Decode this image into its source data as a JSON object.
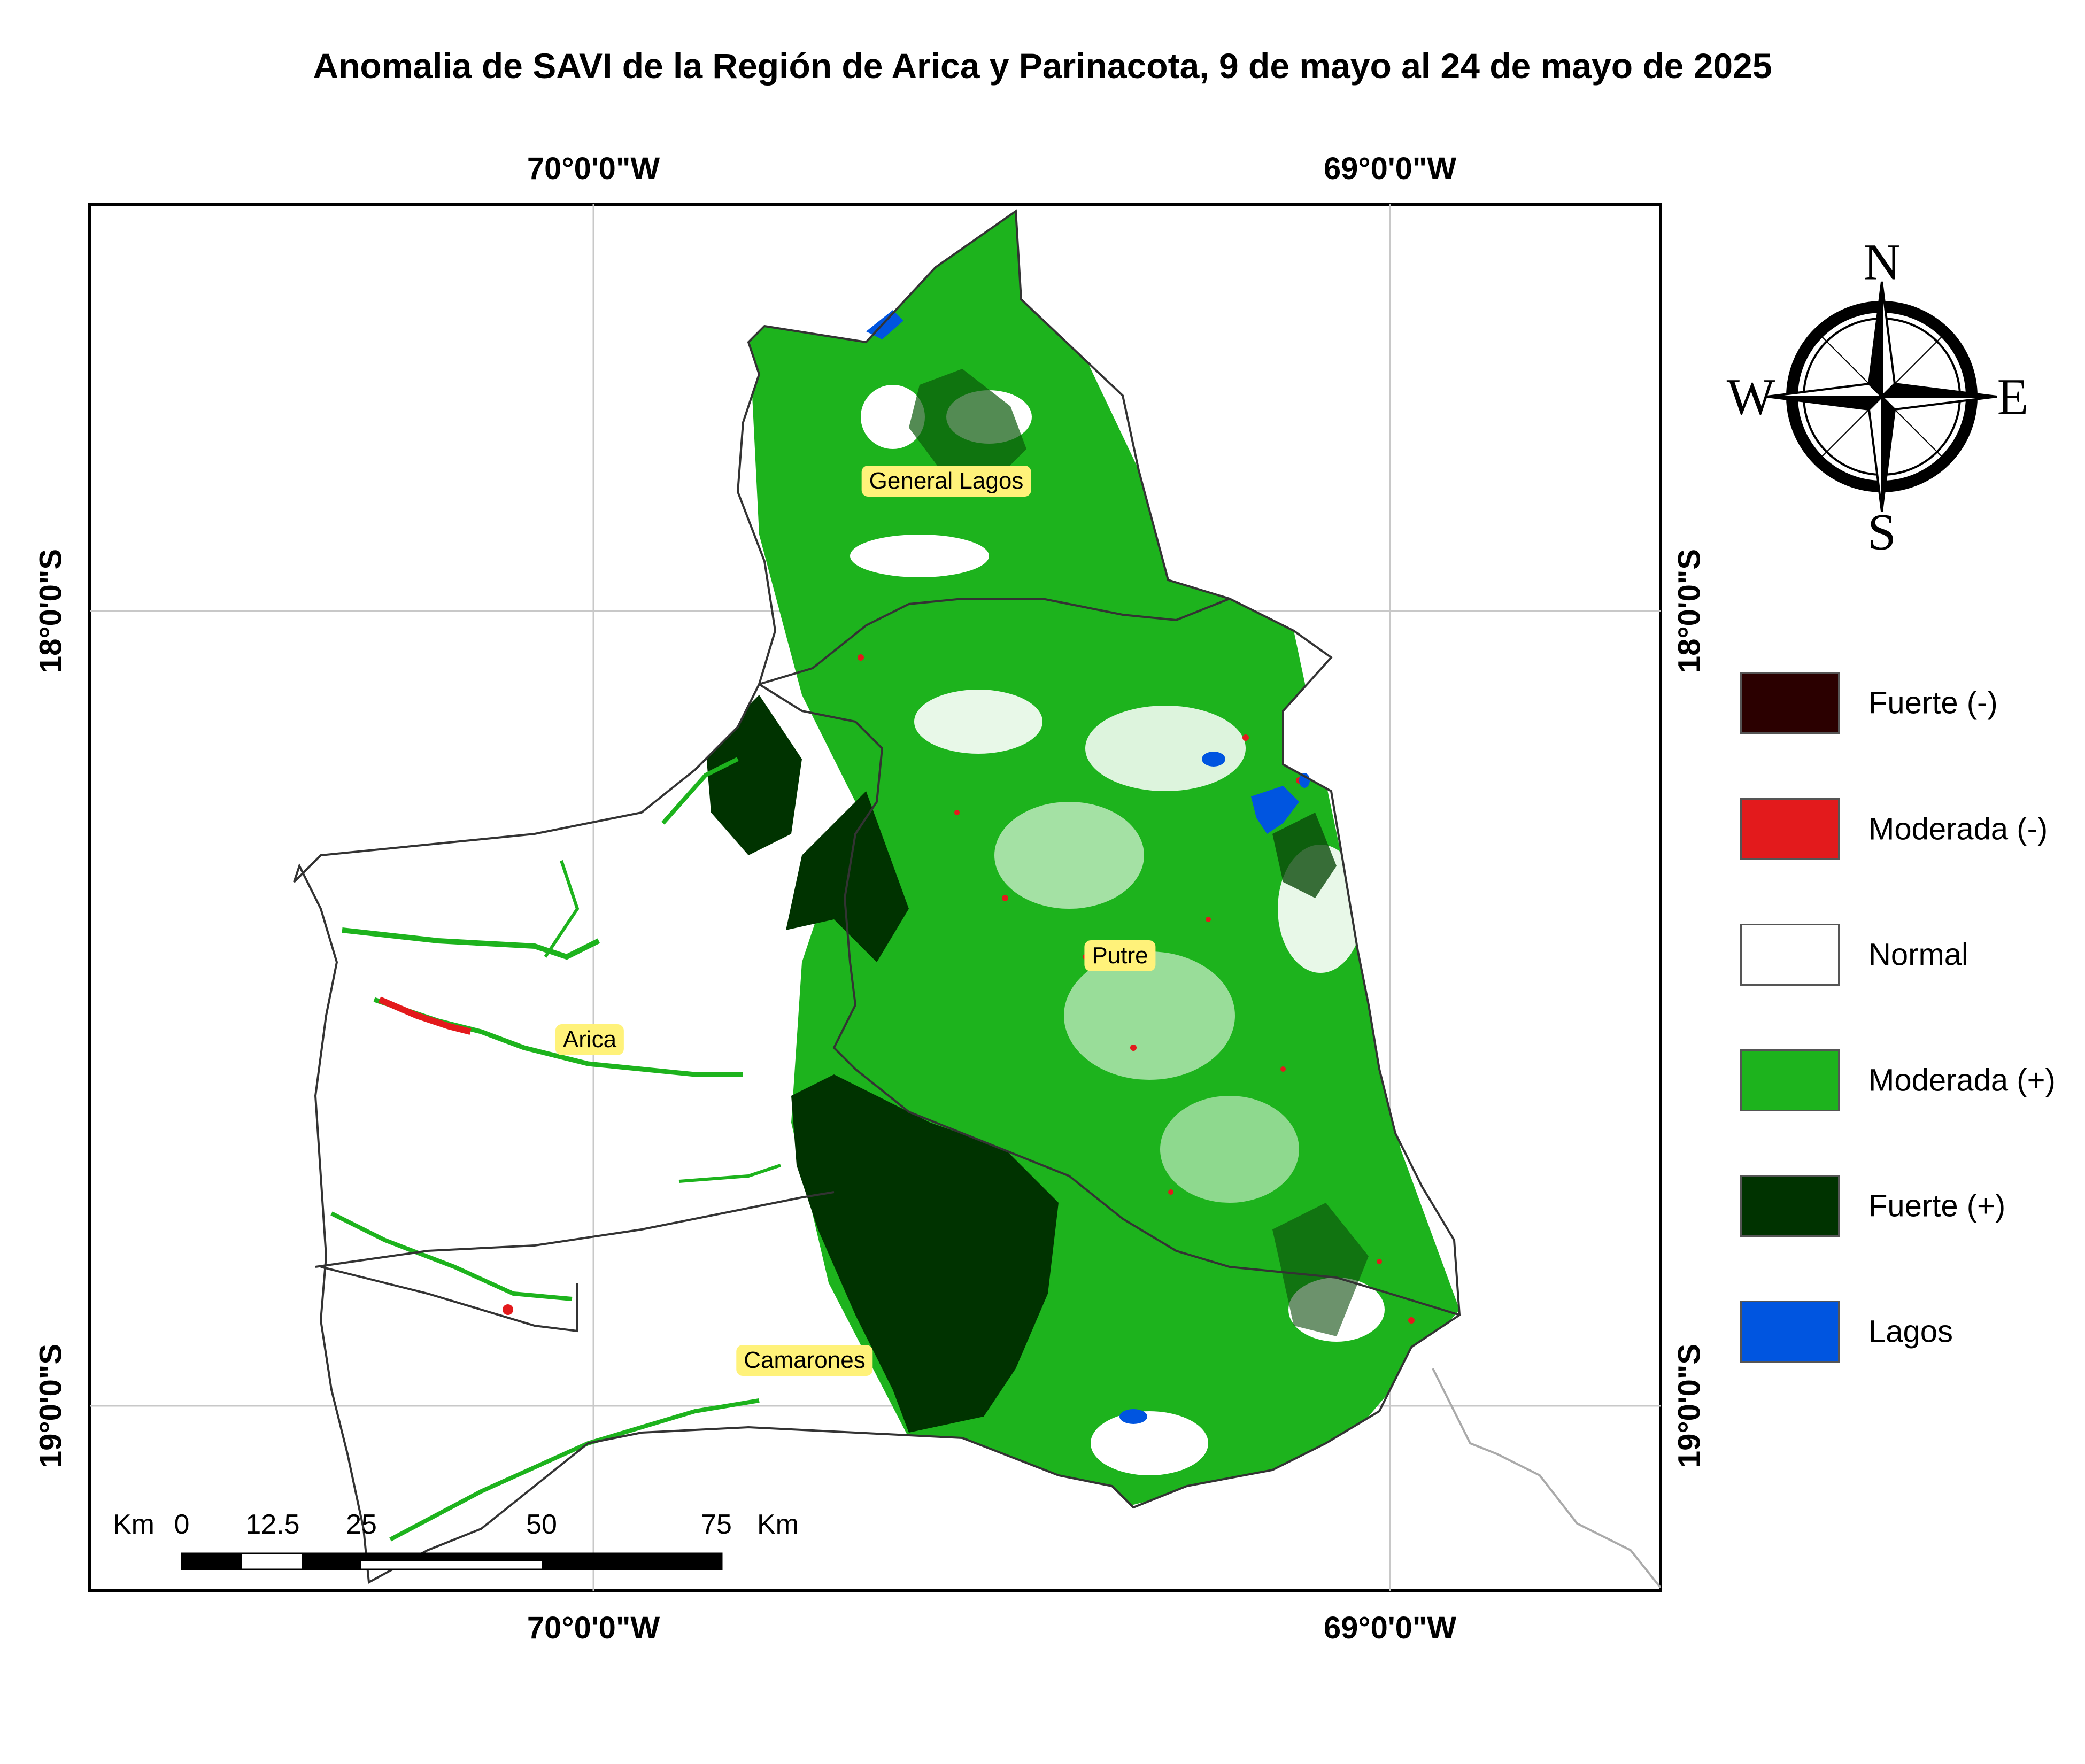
{
  "title": "Anomalia de SAVI de la Región de Arica y Parinacota, 9 de mayo al 24 de mayo de 2025",
  "graticule": {
    "lon_west": "70°0'0\"W",
    "lon_east": "69°0'0\"W",
    "lat_north": "18°0'0\"S",
    "lat_south": "19°0'0\"S"
  },
  "places": {
    "general_lagos": "General Lagos",
    "putre": "Putre",
    "arica": "Arica",
    "camarones": "Camarones"
  },
  "legend": [
    {
      "label": "Fuerte (-)",
      "color": "#2b0000"
    },
    {
      "label": "Moderada (-)",
      "color": "#e31a1c"
    },
    {
      "label": "Normal",
      "color": "#ffffff"
    },
    {
      "label": "Moderada (+)",
      "color": "#1db31d"
    },
    {
      "label": "Fuerte (+)",
      "color": "#003300"
    },
    {
      "label": "Lagos",
      "color": "#0055e0"
    }
  ],
  "compass": {
    "n": "N",
    "s": "S",
    "e": "E",
    "w": "W"
  },
  "scale_bar": {
    "unit_left": "Km",
    "unit_right": "Km",
    "ticks": [
      "0",
      "12.5",
      "25",
      "50",
      "75"
    ]
  }
}
